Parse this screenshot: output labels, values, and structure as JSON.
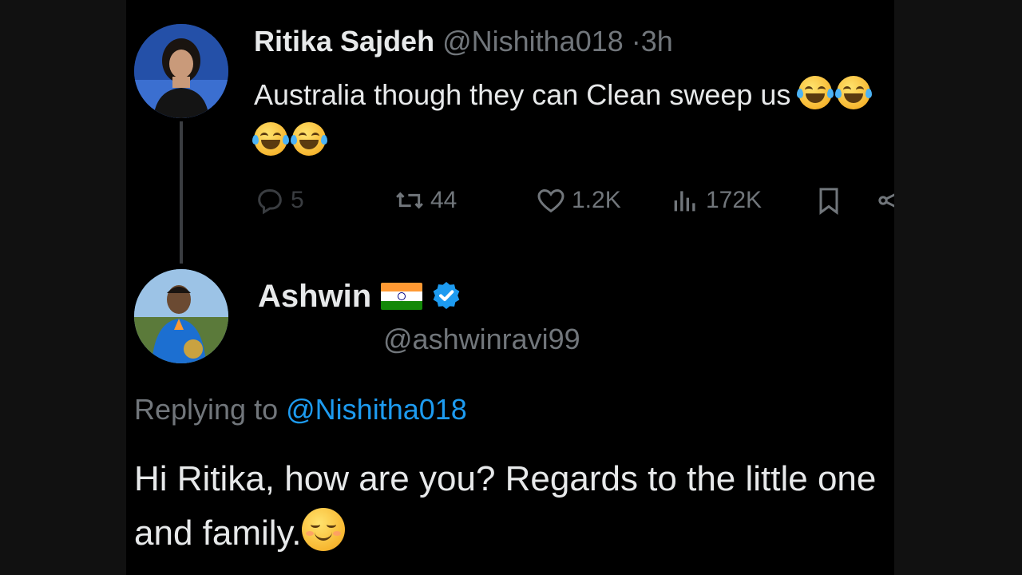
{
  "parent_tweet": {
    "author_name": "Ritika Sajdeh",
    "handle": "@Nishitha018",
    "separator": "·",
    "time": "3h",
    "text": "Australia though they can Clean sweep us",
    "emojis": [
      "rolling-on-floor-laughing",
      "rolling-on-floor-laughing",
      "rolling-on-floor-laughing",
      "rolling-on-floor-laughing"
    ],
    "avatar_icon": "profile-photo-woman",
    "actions": {
      "reply_count": "5",
      "retweet_count": "44",
      "like_count": "1.2K",
      "view_count": "172K"
    }
  },
  "reply_tweet": {
    "author_name": "Ashwin",
    "flag_icon": "india-flag",
    "verified_icon": "verified-badge",
    "handle": "@ashwinravi99",
    "replying_prefix": "Replying to",
    "replying_to": "@Nishitha018",
    "text": "Hi Ritika, how are you? Regards to the little one and family.",
    "emoji": "smiling-face-with-smiling-eyes",
    "avatar_icon": "profile-photo-cricketer"
  },
  "colors": {
    "background": "#000000",
    "text": "#e7e9ea",
    "muted": "#71767b",
    "link": "#1d9bf0",
    "verified": "#1d9bf0"
  }
}
